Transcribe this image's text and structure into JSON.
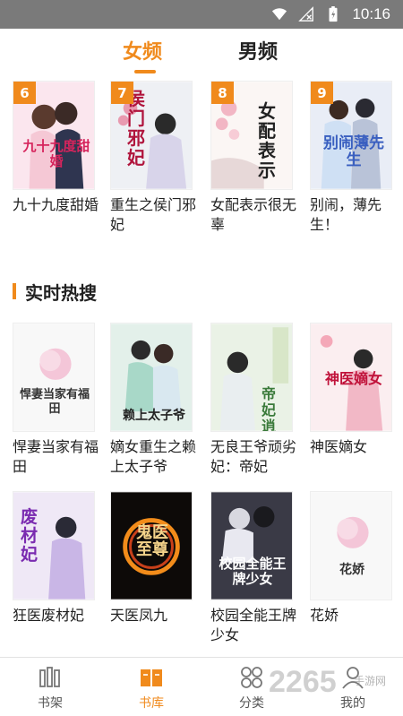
{
  "status_bar": {
    "time": "10:16"
  },
  "tabs": {
    "female": "女频",
    "male": "男频"
  },
  "top_books": [
    {
      "rank": "6",
      "title": "九十九度甜婚",
      "cover_text": "九十九度甜婚"
    },
    {
      "rank": "7",
      "title": "重生之侯门邪妃",
      "cover_text": "侯门邪妃"
    },
    {
      "rank": "8",
      "title": "女配表示很无辜",
      "cover_text": "女配表示"
    },
    {
      "rank": "9",
      "title": "别闹，薄先生！",
      "cover_text": "别闹薄先生"
    }
  ],
  "section": {
    "title": "实时热搜"
  },
  "hot_books": [
    {
      "title": "悍妻当家有福田",
      "cover_text": "悍妻当家有福田"
    },
    {
      "title": "嫡女重生之赖上太子爷",
      "cover_text": "赖上太子爷"
    },
    {
      "title": "无良王爷顽劣妃：帝妃",
      "cover_text": "帝妃逍遥"
    },
    {
      "title": "神医嫡女",
      "cover_text": "神医嫡女"
    },
    {
      "title": "狂医废材妃",
      "cover_text": "废材妃"
    },
    {
      "title": "天医凤九",
      "cover_text": "鬼医至尊"
    },
    {
      "title": "校园全能王牌少女",
      "cover_text": "校园全能王牌少女"
    },
    {
      "title": "花娇",
      "cover_text": "花娇"
    }
  ],
  "bottom_nav": {
    "shelf": "书架",
    "library": "书库",
    "category": "分类",
    "mine": "我的"
  },
  "watermark": {
    "main": "2265",
    "sub": "手游网"
  },
  "colors": {
    "accent": "#f08a1c",
    "status_bar": "#7a7a7a"
  }
}
